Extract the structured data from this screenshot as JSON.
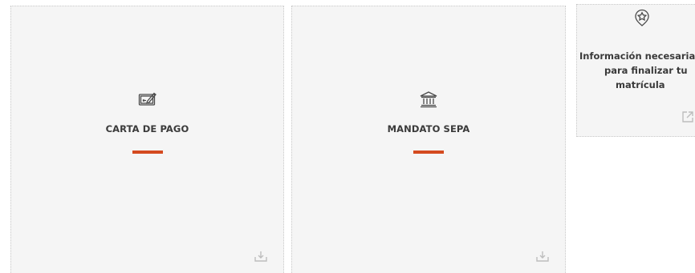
{
  "cards": [
    {
      "title": "CARTA DE PAGO",
      "icon": "check-payment-icon",
      "action_icon": "download-icon"
    },
    {
      "title": "MANDATO SEPA",
      "icon": "bank-icon",
      "action_icon": "download-icon"
    },
    {
      "icon": "badge-star-icon",
      "lines": [
        "Información necesaria",
        "para finalizar tu",
        "matrícula"
      ],
      "action_icon": "external-link-icon"
    }
  ],
  "colors": {
    "accent": "#d44a1f",
    "card_background": "#f5f5f5",
    "text": "#3a3a3a",
    "muted_icon": "#bdbdbd"
  }
}
